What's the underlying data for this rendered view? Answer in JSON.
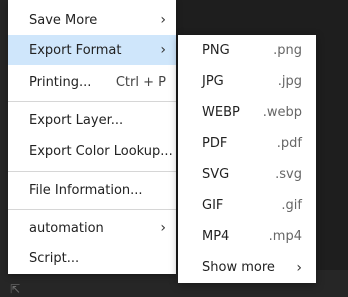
{
  "main_menu": {
    "items": [
      {
        "label": "Save More",
        "has_submenu": true
      },
      {
        "label": "Export Format",
        "has_submenu": true,
        "highlighted": true
      },
      {
        "label": "Printing...",
        "shortcut": "Ctrl + P"
      },
      {
        "label": "Export Layer..."
      },
      {
        "label": "Export Color Lookup..."
      },
      {
        "label": "File Information..."
      },
      {
        "label": "automation",
        "has_submenu": true
      },
      {
        "label": "Script..."
      }
    ]
  },
  "submenu": {
    "items": [
      {
        "label": "PNG",
        "ext": ".png"
      },
      {
        "label": "JPG",
        "ext": ".jpg"
      },
      {
        "label": "WEBP",
        "ext": ".webp"
      },
      {
        "label": "PDF",
        "ext": ".pdf"
      },
      {
        "label": "SVG",
        "ext": ".svg"
      },
      {
        "label": "GIF",
        "ext": ".gif"
      },
      {
        "label": "MP4",
        "ext": ".mp4"
      },
      {
        "label": "Show more",
        "has_submenu": true
      }
    ]
  },
  "icons": {
    "chevron": "›",
    "corner": "⇱"
  },
  "colors": {
    "highlight": "#cfe6fb",
    "menu_bg": "#ffffff",
    "backdrop": "#1e1e1e"
  }
}
